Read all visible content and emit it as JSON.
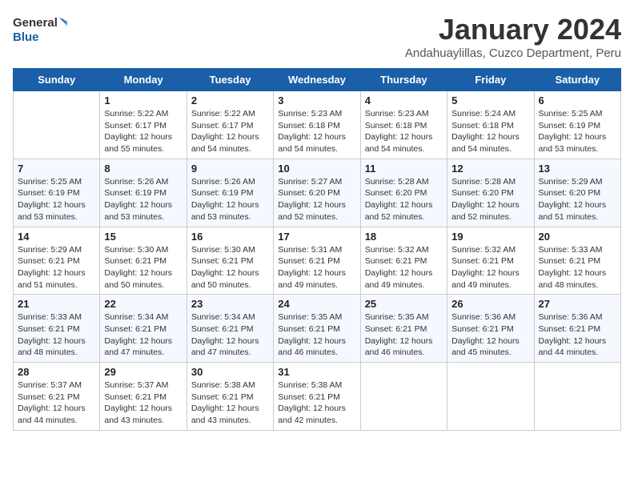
{
  "logo": {
    "line1": "General",
    "line2": "Blue"
  },
  "title": "January 2024",
  "subtitle": "Andahuaylillas, Cuzco Department, Peru",
  "days_header": [
    "Sunday",
    "Monday",
    "Tuesday",
    "Wednesday",
    "Thursday",
    "Friday",
    "Saturday"
  ],
  "weeks": [
    [
      {
        "num": "",
        "text": ""
      },
      {
        "num": "1",
        "text": "Sunrise: 5:22 AM\nSunset: 6:17 PM\nDaylight: 12 hours\nand 55 minutes."
      },
      {
        "num": "2",
        "text": "Sunrise: 5:22 AM\nSunset: 6:17 PM\nDaylight: 12 hours\nand 54 minutes."
      },
      {
        "num": "3",
        "text": "Sunrise: 5:23 AM\nSunset: 6:18 PM\nDaylight: 12 hours\nand 54 minutes."
      },
      {
        "num": "4",
        "text": "Sunrise: 5:23 AM\nSunset: 6:18 PM\nDaylight: 12 hours\nand 54 minutes."
      },
      {
        "num": "5",
        "text": "Sunrise: 5:24 AM\nSunset: 6:18 PM\nDaylight: 12 hours\nand 54 minutes."
      },
      {
        "num": "6",
        "text": "Sunrise: 5:25 AM\nSunset: 6:19 PM\nDaylight: 12 hours\nand 53 minutes."
      }
    ],
    [
      {
        "num": "7",
        "text": "Sunrise: 5:25 AM\nSunset: 6:19 PM\nDaylight: 12 hours\nand 53 minutes."
      },
      {
        "num": "8",
        "text": "Sunrise: 5:26 AM\nSunset: 6:19 PM\nDaylight: 12 hours\nand 53 minutes."
      },
      {
        "num": "9",
        "text": "Sunrise: 5:26 AM\nSunset: 6:19 PM\nDaylight: 12 hours\nand 53 minutes."
      },
      {
        "num": "10",
        "text": "Sunrise: 5:27 AM\nSunset: 6:20 PM\nDaylight: 12 hours\nand 52 minutes."
      },
      {
        "num": "11",
        "text": "Sunrise: 5:28 AM\nSunset: 6:20 PM\nDaylight: 12 hours\nand 52 minutes."
      },
      {
        "num": "12",
        "text": "Sunrise: 5:28 AM\nSunset: 6:20 PM\nDaylight: 12 hours\nand 52 minutes."
      },
      {
        "num": "13",
        "text": "Sunrise: 5:29 AM\nSunset: 6:20 PM\nDaylight: 12 hours\nand 51 minutes."
      }
    ],
    [
      {
        "num": "14",
        "text": "Sunrise: 5:29 AM\nSunset: 6:21 PM\nDaylight: 12 hours\nand 51 minutes."
      },
      {
        "num": "15",
        "text": "Sunrise: 5:30 AM\nSunset: 6:21 PM\nDaylight: 12 hours\nand 50 minutes."
      },
      {
        "num": "16",
        "text": "Sunrise: 5:30 AM\nSunset: 6:21 PM\nDaylight: 12 hours\nand 50 minutes."
      },
      {
        "num": "17",
        "text": "Sunrise: 5:31 AM\nSunset: 6:21 PM\nDaylight: 12 hours\nand 49 minutes."
      },
      {
        "num": "18",
        "text": "Sunrise: 5:32 AM\nSunset: 6:21 PM\nDaylight: 12 hours\nand 49 minutes."
      },
      {
        "num": "19",
        "text": "Sunrise: 5:32 AM\nSunset: 6:21 PM\nDaylight: 12 hours\nand 49 minutes."
      },
      {
        "num": "20",
        "text": "Sunrise: 5:33 AM\nSunset: 6:21 PM\nDaylight: 12 hours\nand 48 minutes."
      }
    ],
    [
      {
        "num": "21",
        "text": "Sunrise: 5:33 AM\nSunset: 6:21 PM\nDaylight: 12 hours\nand 48 minutes."
      },
      {
        "num": "22",
        "text": "Sunrise: 5:34 AM\nSunset: 6:21 PM\nDaylight: 12 hours\nand 47 minutes."
      },
      {
        "num": "23",
        "text": "Sunrise: 5:34 AM\nSunset: 6:21 PM\nDaylight: 12 hours\nand 47 minutes."
      },
      {
        "num": "24",
        "text": "Sunrise: 5:35 AM\nSunset: 6:21 PM\nDaylight: 12 hours\nand 46 minutes."
      },
      {
        "num": "25",
        "text": "Sunrise: 5:35 AM\nSunset: 6:21 PM\nDaylight: 12 hours\nand 46 minutes."
      },
      {
        "num": "26",
        "text": "Sunrise: 5:36 AM\nSunset: 6:21 PM\nDaylight: 12 hours\nand 45 minutes."
      },
      {
        "num": "27",
        "text": "Sunrise: 5:36 AM\nSunset: 6:21 PM\nDaylight: 12 hours\nand 44 minutes."
      }
    ],
    [
      {
        "num": "28",
        "text": "Sunrise: 5:37 AM\nSunset: 6:21 PM\nDaylight: 12 hours\nand 44 minutes."
      },
      {
        "num": "29",
        "text": "Sunrise: 5:37 AM\nSunset: 6:21 PM\nDaylight: 12 hours\nand 43 minutes."
      },
      {
        "num": "30",
        "text": "Sunrise: 5:38 AM\nSunset: 6:21 PM\nDaylight: 12 hours\nand 43 minutes."
      },
      {
        "num": "31",
        "text": "Sunrise: 5:38 AM\nSunset: 6:21 PM\nDaylight: 12 hours\nand 42 minutes."
      },
      {
        "num": "",
        "text": ""
      },
      {
        "num": "",
        "text": ""
      },
      {
        "num": "",
        "text": ""
      }
    ]
  ]
}
